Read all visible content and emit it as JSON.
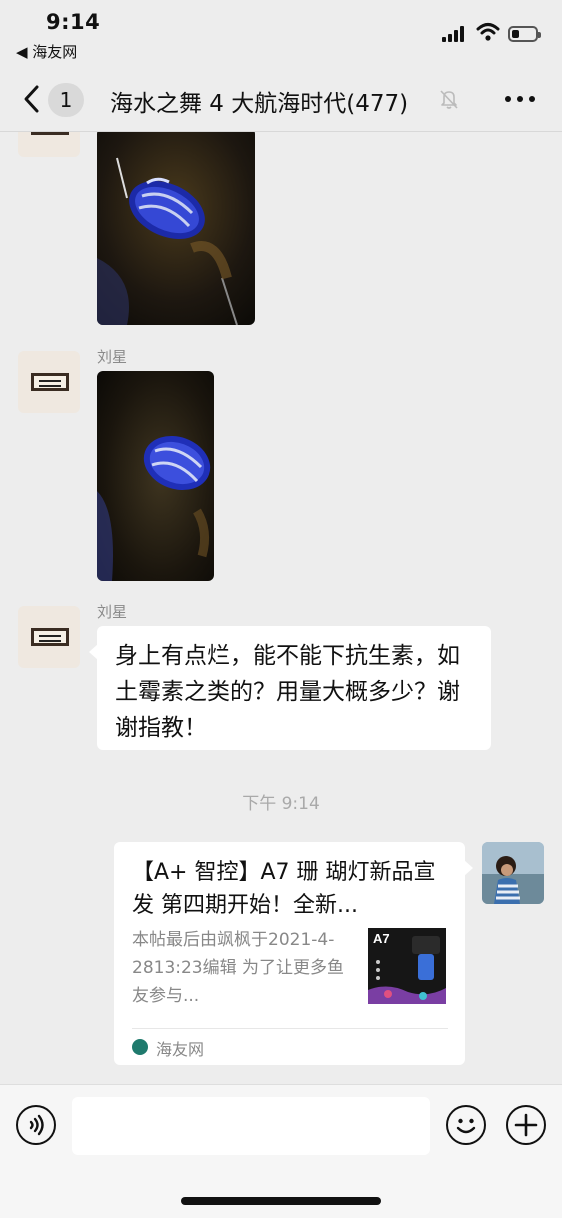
{
  "status_bar": {
    "time": "9:14",
    "back_app": "◀ 海友网",
    "battery_level": 0.3
  },
  "nav": {
    "unread_count": "1",
    "title": "海水之舞 4 大航海时代(477)"
  },
  "messages": [
    {
      "type": "image",
      "sender": ""
    },
    {
      "type": "image",
      "sender": "刘星"
    },
    {
      "type": "text",
      "sender": "刘星",
      "text": "身上有点烂，能不能下抗生素，如土霉素之类的？用量大概多少？谢谢指教！"
    },
    {
      "type": "timestamp",
      "text": "下午 9:14"
    },
    {
      "type": "link",
      "title": "【A+ 智控】A7 珊 瑚灯新品宣发  第四期开始！全新...",
      "description": "本帖最后由飒枫于2021-4-2813:23编辑 为了让更多鱼友参与...",
      "thumb_label": "A7",
      "source": "海友网"
    }
  ],
  "input_bar": {
    "placeholder": ""
  },
  "colors": {
    "background": "#ededed",
    "bubble": "#ffffff",
    "muted_text": "#888888",
    "source_icon": "#1f7a6d"
  }
}
